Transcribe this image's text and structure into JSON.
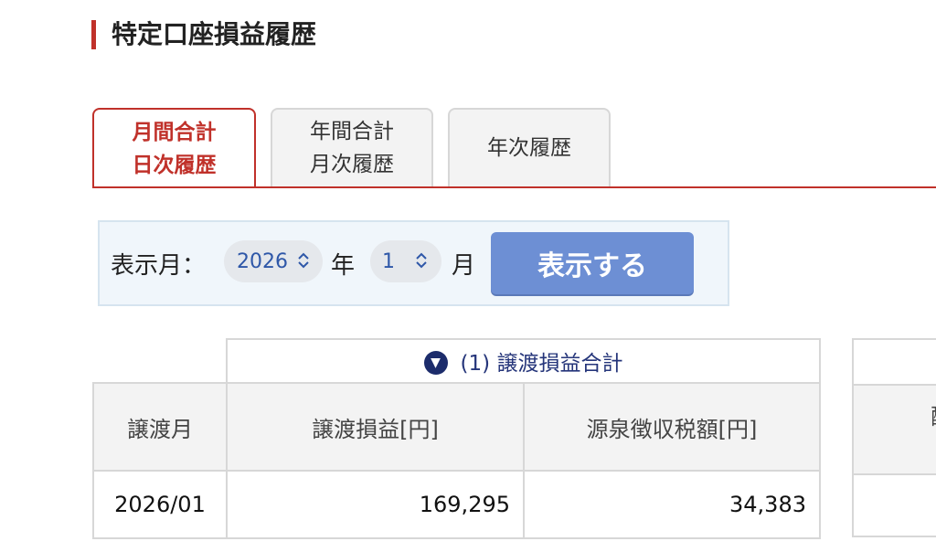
{
  "page_title": "特定口座損益履歴",
  "tabs": [
    {
      "line1": "月間合計",
      "line2": "日次履歴",
      "active": true
    },
    {
      "line1": "年間合計",
      "line2": "月次履歴",
      "active": false
    },
    {
      "line1": "年次履歴",
      "line2": "",
      "active": false
    }
  ],
  "filter": {
    "label": "表示月：",
    "year_value": "2026",
    "year_unit": "年",
    "month_value": "1",
    "month_unit": "月",
    "submit_label": "表示する"
  },
  "table": {
    "group_title": "(1) 譲渡損益合計",
    "headers": [
      "譲渡月",
      "譲渡損益[円]",
      "源泉徴収税額[円]"
    ],
    "rows": [
      [
        "2026/01",
        "169,295",
        "34,383"
      ]
    ]
  },
  "side_table": {
    "header_fragment": "配"
  },
  "colors": {
    "accent_red": "#c0312a",
    "button_blue": "#6d8fd4",
    "select_text": "#2e57a8",
    "group_title": "#25357a"
  },
  "icons": {
    "group_toggle": "triangle-down-circle-icon",
    "select_chevron": "chevron-up-down-icon"
  }
}
